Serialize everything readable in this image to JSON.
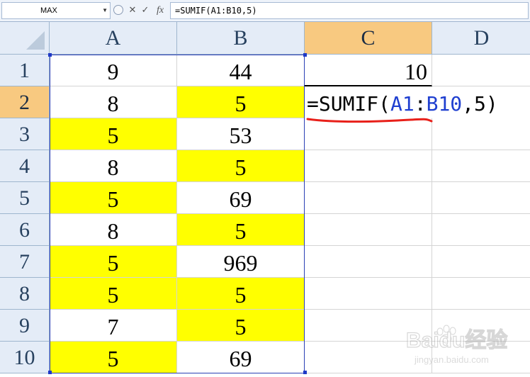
{
  "formula_bar": {
    "name_box": "MAX",
    "cancel_symbol": "✕",
    "enter_symbol": "✓",
    "fx_symbol": "fx",
    "formula": "=SUMIF(A1:B10,5)"
  },
  "columns": [
    "A",
    "B",
    "C",
    "D"
  ],
  "active_column": "C",
  "active_row": "2",
  "rows": [
    {
      "label": "1",
      "A": "9",
      "B": "44",
      "C": "10"
    },
    {
      "label": "2",
      "A": "8",
      "B": "5",
      "C": ""
    },
    {
      "label": "3",
      "A": "5",
      "B": "53",
      "C": ""
    },
    {
      "label": "4",
      "A": "8",
      "B": "5",
      "C": ""
    },
    {
      "label": "5",
      "A": "5",
      "B": "69",
      "C": ""
    },
    {
      "label": "6",
      "A": "8",
      "B": "5",
      "C": ""
    },
    {
      "label": "7",
      "A": "5",
      "B": "969",
      "C": ""
    },
    {
      "label": "8",
      "A": "5",
      "B": "5",
      "C": ""
    },
    {
      "label": "9",
      "A": "7",
      "B": "5",
      "C": ""
    },
    {
      "label": "10",
      "A": "5",
      "B": "69",
      "C": ""
    }
  ],
  "highlight_color": "#ffff00",
  "editing_formula": {
    "prefix": "=SUMIF(",
    "ref_part1": "A1",
    "colon": ":",
    "ref_part2": "B10",
    "suffix": ",5)"
  },
  "watermark_text": "Baidu经验",
  "watermark_url": "jingyan.baidu.com",
  "underline_color": "#e8201a"
}
